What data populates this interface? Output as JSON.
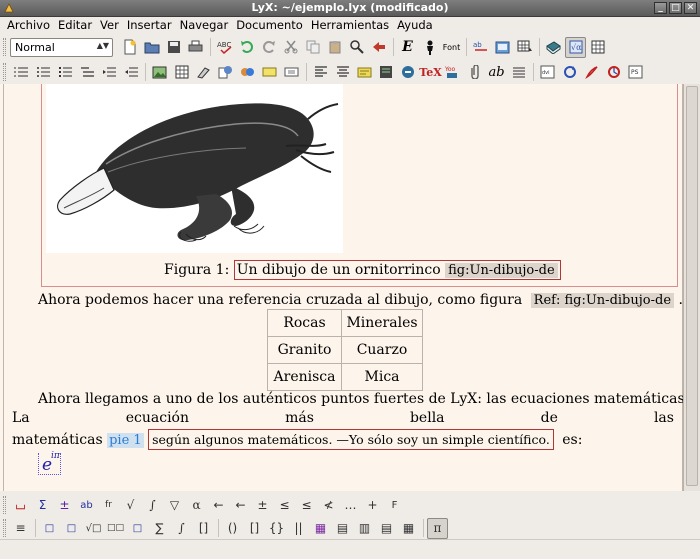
{
  "window": {
    "title": "LyX: ~/ejemplo.lyx (modificado)",
    "buttons": [
      "_",
      "□",
      "✕"
    ]
  },
  "menu": [
    "Archivo",
    "Editar",
    "Ver",
    "Insertar",
    "Navegar",
    "Documento",
    "Herramientas",
    "Ayuda"
  ],
  "toolbar1": {
    "style_combo": "Normal",
    "icons": [
      "new-document-icon",
      "open-icon",
      "save-icon",
      "print-icon",
      "spellcheck-icon",
      "undo-icon",
      "redo-icon",
      "cut-icon",
      "copy-icon",
      "paste-icon",
      "find-replace-icon",
      "navigate-back-icon",
      "emphasis-icon",
      "noun-icon",
      "font-icon",
      "change-tracking-icon",
      "view-pdf-icon",
      "table-icon",
      "book-icon",
      "math-panel-icon",
      "table-panel-icon"
    ],
    "font_label": "Font",
    "emph_label": "E"
  },
  "toolbar2": {
    "icons": [
      "numbered-list-icon",
      "itemize-icon",
      "enumerate-icon",
      "description-icon",
      "increase-depth-icon",
      "decrease-depth-icon",
      "insert-graphics-icon",
      "insert-table-icon",
      "insert-url-icon",
      "insert-note-icon",
      "insert-branch-icon",
      "insert-box-icon",
      "align-left-icon",
      "align-center-icon",
      "insert-note-yellow-icon",
      "insert-footnote-icon",
      "insert-marginal-icon",
      "tex-code-icon",
      "bibtex-icon",
      "insert-citation-icon",
      "insert-label-icon",
      "insert-ref-icon",
      "math-mode-icon",
      "view-dvi-icon",
      "update-icon",
      "view-pdf-icon",
      "update-pdf-icon",
      "view-ps-icon"
    ],
    "tex_label": "TeX",
    "ab_label": "ab"
  },
  "document": {
    "figure_caption_prefix": "Figura 1:",
    "figure_caption_text": "Un dibujo de un ornitorrinco",
    "figure_label": "fig:Un-dibujo-de",
    "para1_text": "Ahora podemos hacer una referencia cruzada al dibujo, como figura",
    "para1_ref": "Ref: fig:Un-dibujo-de",
    "para1_end": ".",
    "table": [
      [
        "Rocas",
        "Minerales"
      ],
      [
        "Granito",
        "Cuarzo"
      ],
      [
        "Arenisca",
        "Mica"
      ]
    ],
    "para2_line1": "Ahora llegamos a uno de los auténticos puntos fuertes de LyX: las ecuaciones matemáticas.",
    "para2_words": [
      "La",
      "ecuación",
      "más",
      "bella",
      "de",
      "las"
    ],
    "para2_line3_start": "matemáticas",
    "footnote_label": "pie 1",
    "footnote_text": "según algunos matemáticos. —Yo sólo soy un simple científico.",
    "para2_line3_end": "es:",
    "math_base": "e",
    "math_exp": "iπ"
  },
  "math_toolbar1": [
    "⌴",
    "Σ",
    "±",
    "ab",
    "fr",
    "√",
    "∫",
    "▽",
    "α",
    "←",
    "←",
    "±",
    "≤",
    "≤",
    "≮",
    "…",
    "+",
    "F"
  ],
  "math_toolbar2": [
    "≡",
    "□",
    "□",
    "√□",
    "□□",
    "□",
    "∑",
    "∫",
    "[]",
    "()",
    "[]",
    "{}",
    "||",
    "▦",
    "▤",
    "▥",
    "▤",
    "▦",
    "π"
  ]
}
